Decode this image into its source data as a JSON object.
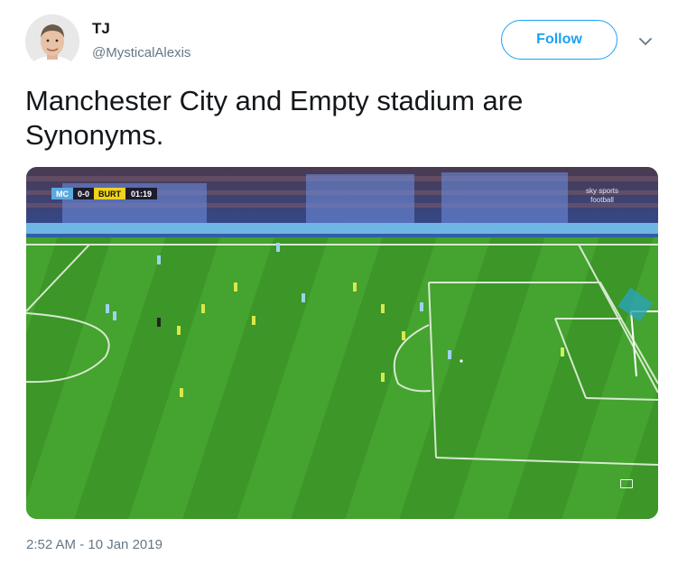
{
  "author": {
    "display_name": "TJ",
    "handle": "@MysticalAlexis",
    "avatar_icon": "profile-photo"
  },
  "follow_label": "Follow",
  "caret_icon": "chevron-down-icon",
  "tweet": {
    "text": "Manchester City and Empty stadium are Synonyms."
  },
  "media": {
    "scoreboard": {
      "home": "MC",
      "score": "0-0",
      "away": "BURT",
      "clock": "01:19"
    },
    "broadcaster": "sky sports football",
    "expand_icon": "fullscreen-icon",
    "pitch_color": "#3f9a2e",
    "stand_color": "#2e4a9a"
  },
  "timestamp": "2:52 AM - 10 Jan 2019",
  "colors": {
    "accent": "#1da1f2",
    "secondary_text": "#657786"
  }
}
